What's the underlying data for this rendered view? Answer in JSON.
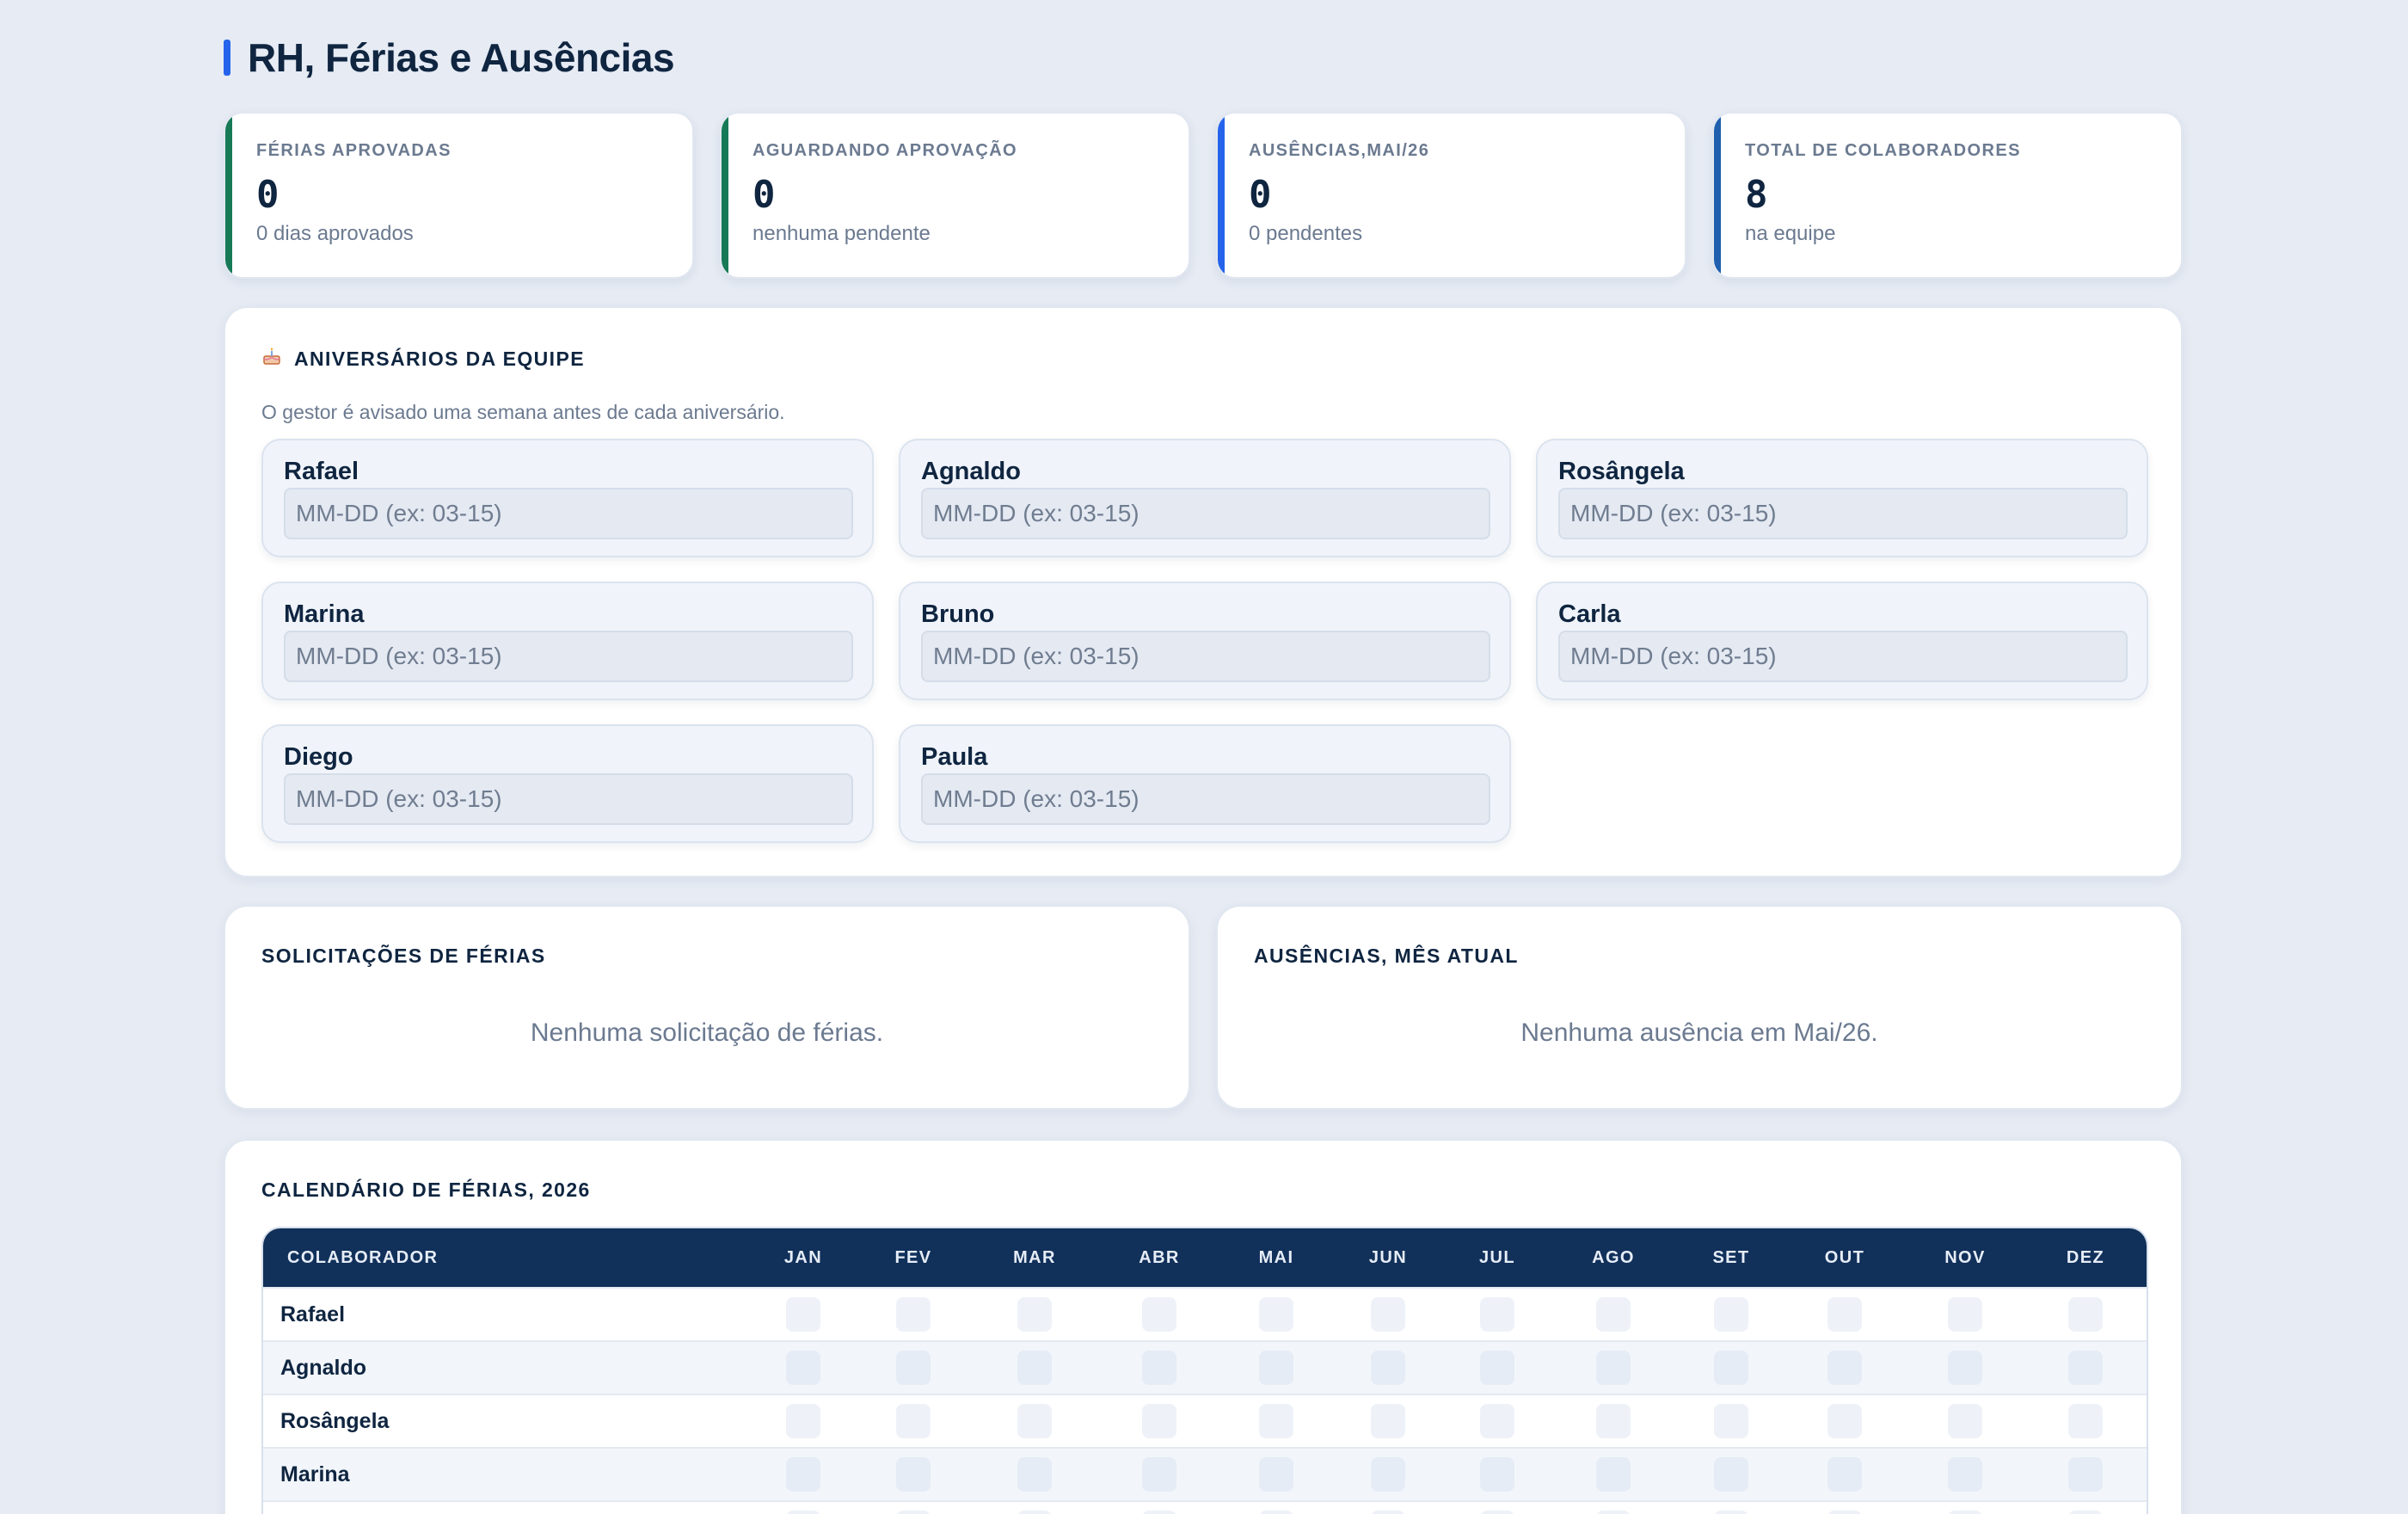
{
  "page": {
    "title": "RH, Férias e Ausências",
    "accent_color": "#2563eb"
  },
  "stats": [
    {
      "label": "FÉRIAS APROVADAS",
      "value": "0",
      "sub": "0 dias aprovados",
      "color": "#167a57"
    },
    {
      "label": "AGUARDANDO APROVAÇÃO",
      "value": "0",
      "sub": "nenhuma pendente",
      "color": "#167a57"
    },
    {
      "label": "AUSÊNCIAS,MAI/26",
      "value": "0",
      "sub": "0 pendentes",
      "color": "#2563eb"
    },
    {
      "label": "TOTAL DE COLABORADORES",
      "value": "8",
      "sub": "na equipe",
      "color": "#1f5fae"
    }
  ],
  "birthdays": {
    "icon": "birthday-cake-icon",
    "title": "ANIVERSÁRIOS DA EQUIPE",
    "description": "O gestor é avisado uma semana antes de cada aniversário.",
    "placeholder": "MM-DD (ex: 03-15)",
    "people": [
      {
        "name": "Rafael",
        "value": ""
      },
      {
        "name": "Agnaldo",
        "value": ""
      },
      {
        "name": "Rosângela",
        "value": ""
      },
      {
        "name": "Marina",
        "value": ""
      },
      {
        "name": "Bruno",
        "value": ""
      },
      {
        "name": "Carla",
        "value": ""
      },
      {
        "name": "Diego",
        "value": ""
      },
      {
        "name": "Paula",
        "value": ""
      }
    ]
  },
  "requests": {
    "title": "SOLICITAÇÕES DE FÉRIAS",
    "empty": "Nenhuma solicitação de férias."
  },
  "absences": {
    "title": "AUSÊNCIAS, MÊS ATUAL",
    "empty": "Nenhuma ausência em Mai/26."
  },
  "calendar": {
    "title": "CALENDÁRIO DE FÉRIAS, 2026",
    "header_color": "#11305a",
    "name_header": "COLABORADOR",
    "months": [
      "JAN",
      "FEV",
      "MAR",
      "ABR",
      "MAI",
      "JUN",
      "JUL",
      "AGO",
      "SET",
      "OUT",
      "NOV",
      "DEZ"
    ],
    "rows": [
      "Rafael",
      "Agnaldo",
      "Rosângela",
      "Marina",
      ""
    ]
  }
}
